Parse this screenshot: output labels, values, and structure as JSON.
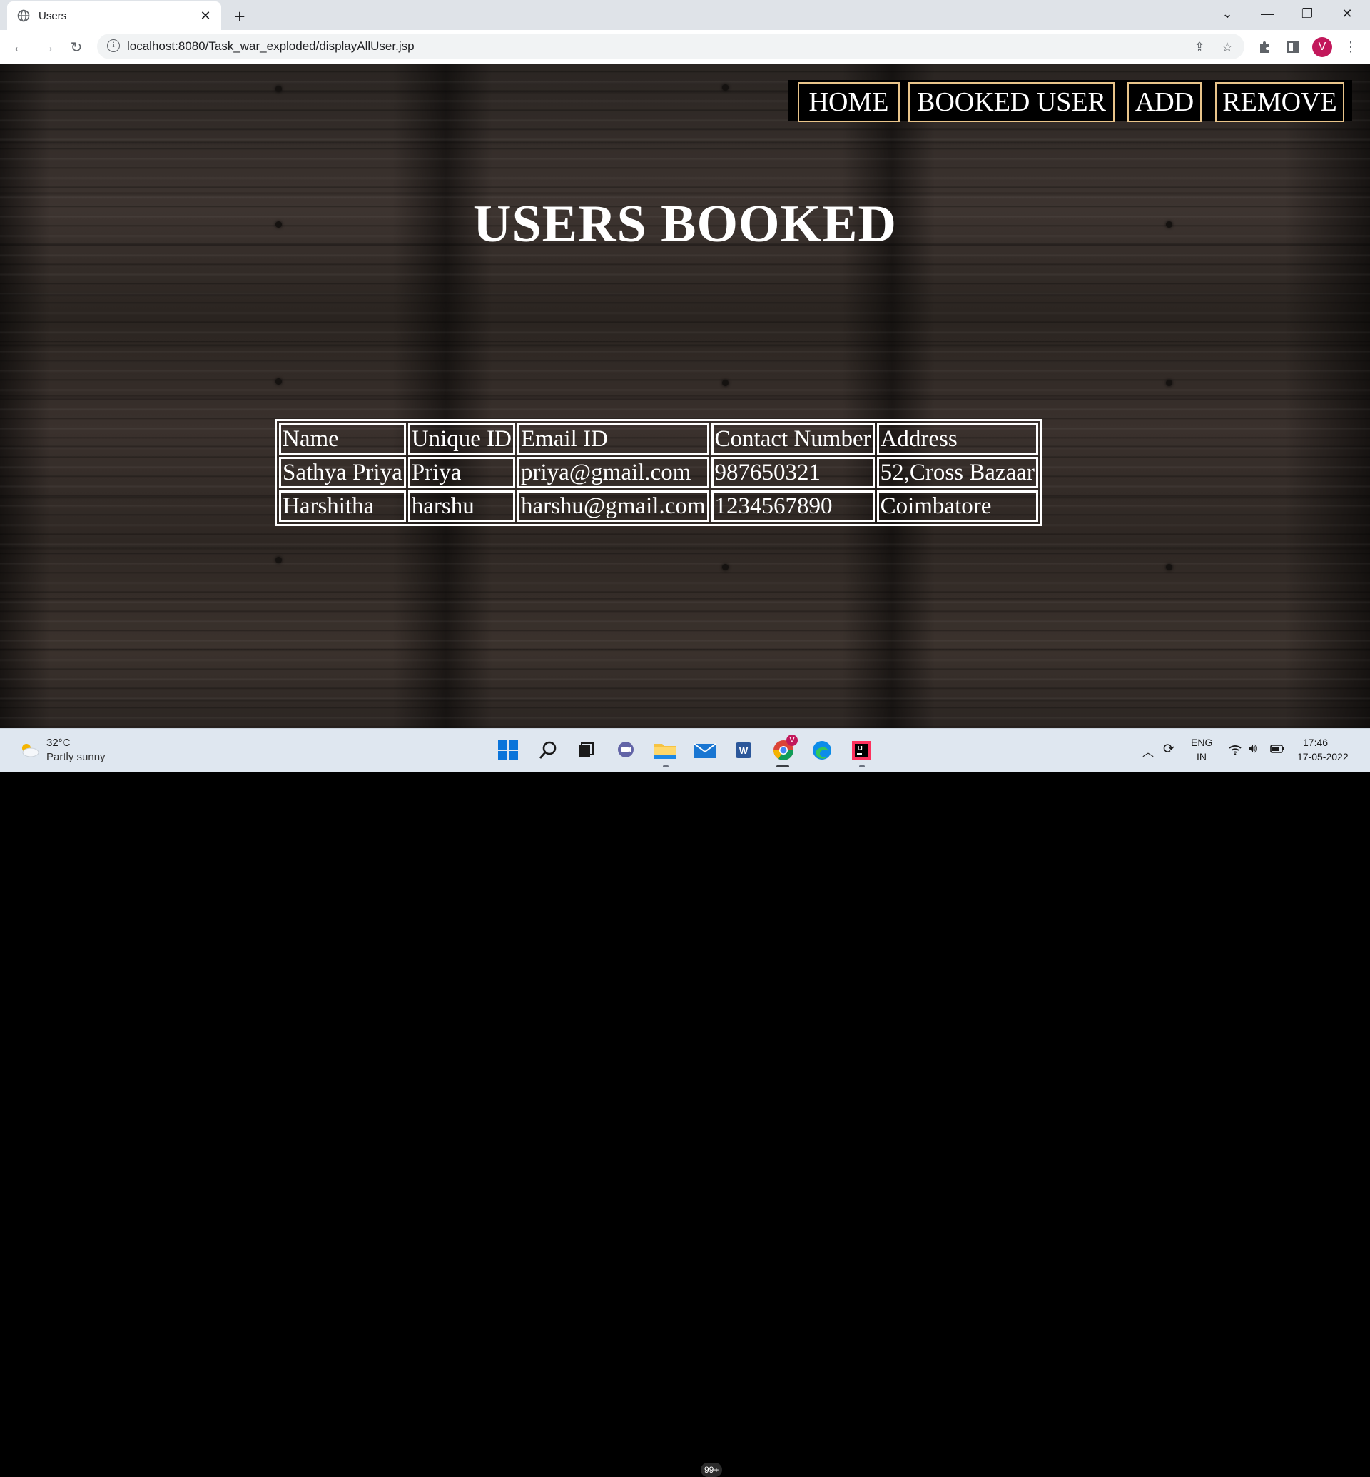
{
  "browser": {
    "tab_title": "Users",
    "url": "localhost:8080/Task_war_exploded/displayAllUser.jsp",
    "profile_initial": "V"
  },
  "page": {
    "nav": [
      "HOME",
      "BOOKED USER",
      "ADD",
      "REMOVE"
    ],
    "title": "USERS BOOKED",
    "table": {
      "headers": [
        "Name",
        "Unique ID",
        "Email ID",
        "Contact Number",
        "Address"
      ],
      "rows": [
        [
          "Sathya Priya",
          "Priya",
          "priya@gmail.com",
          "987650321",
          "52,Cross Bazaar"
        ],
        [
          "Harshitha",
          "harshu",
          "harshu@gmail.com",
          "1234567890",
          "Coimbatore"
        ]
      ]
    }
  },
  "taskbar": {
    "weather_temp": "32°C",
    "weather_desc": "Partly sunny",
    "mail_badge": "99+",
    "chrome_badge": "V",
    "lang": "ENG",
    "region": "IN",
    "time": "17:46",
    "date": "17-05-2022"
  },
  "colors": {
    "nav_border": "#e8c48a",
    "wood_base": "#3a312d",
    "profile": "#c2185b"
  }
}
